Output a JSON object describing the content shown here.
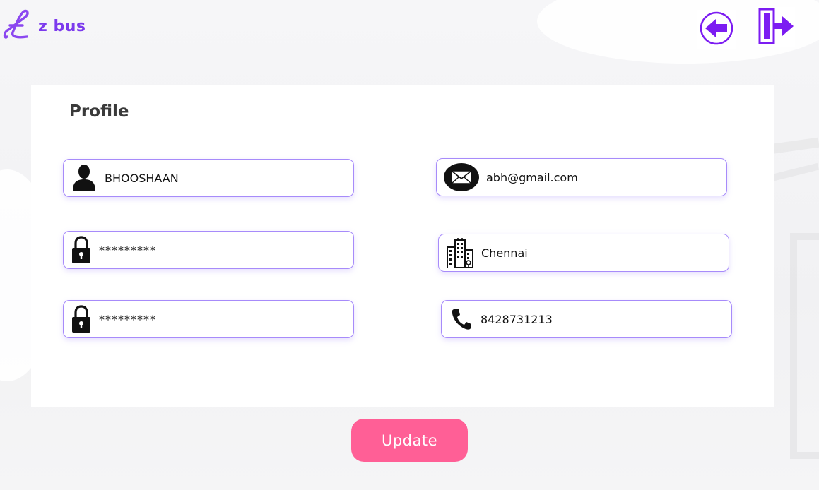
{
  "app": {
    "name": "z bus"
  },
  "nav": {
    "back_icon": "back-arrow-icon",
    "logout_icon": "logout-icon"
  },
  "profile": {
    "title": "Profile",
    "fields": {
      "name": {
        "value": "BHOOSHAAN",
        "icon": "user-icon"
      },
      "email": {
        "value": "abh@gmail.com",
        "icon": "envelope-icon"
      },
      "password": {
        "value": "*********",
        "icon": "lock-icon"
      },
      "city": {
        "value": "Chennai",
        "icon": "city-buildings-icon"
      },
      "confirm_password": {
        "value": "*********",
        "icon": "lock-icon"
      },
      "phone": {
        "value": "8428731213",
        "icon": "phone-icon"
      }
    },
    "update_label": "Update"
  },
  "colors": {
    "brand": "#7c3aed",
    "field_border": "#a78bfa",
    "button": "#ff5f96",
    "title": "#3a3a3a"
  }
}
